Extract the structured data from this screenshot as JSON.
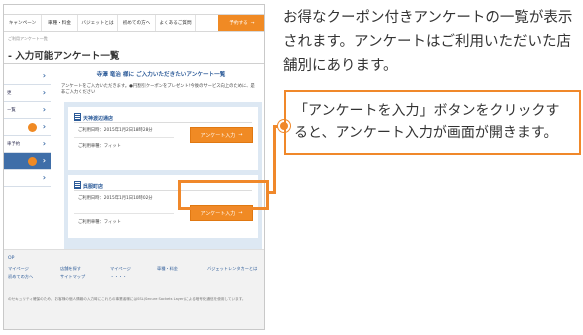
{
  "nav": {
    "items": [
      "キャンペーン",
      "車種・料金",
      "バジェットとは",
      "初めての方へ",
      "よくあるご質問"
    ],
    "cta_label": "予約する",
    "cta_arrow": "→"
  },
  "breadcrumb": "ご利用アンケート一覧",
  "page_title": "- 入力可能アンケート一覧",
  "sidebar": {
    "items": [
      {
        "label": ""
      },
      {
        "label": "更"
      },
      {
        "label": "ー覧"
      },
      {
        "label": ""
      },
      {
        "label": "車予約"
      },
      {
        "label": ""
      },
      {
        "label": ""
      }
    ],
    "chevron": "›"
  },
  "main": {
    "greeting": "寺澤 竜治 様に ご入力いただきたいアンケート一覧",
    "intro": "アンケートをご入力いただきます。●円割引クーポンをプレゼント!今後のサービス向上のために、是非ご入力ください"
  },
  "cards": [
    {
      "store": "天神渡辺通店",
      "date": "ご利用日時：2015年1月2日18時28分",
      "plan": "ご利用車種：フィット",
      "button_label": "アンケート入力",
      "button_arrow": "→"
    },
    {
      "store": "呉服町店",
      "date": "ご利用日時：2015年1月1日10時02分",
      "plan": "ご利用車種：フィット",
      "button_label": "アンケート入力",
      "button_arrow": "→"
    }
  ],
  "footer": {
    "top": "OP",
    "col1": [
      "マイページ",
      "初めての方へ"
    ],
    "col2": [
      "店舗を探す",
      "サイトマップ"
    ],
    "col3": [
      "マイページ",
      "・・・・"
    ],
    "col4": [
      "車種・料金"
    ],
    "col5": [
      "バジェットレンタカーとは"
    ],
    "legal": "のセキュリティ確保のため、お客様の個人情報の入力時にこれらの事業者様にはSSL(Secure Sockets Layer)による暗号化通信を使用しています。"
  },
  "right": {
    "description": "お得なクーポン付きアンケートの一覧が表示されます。アンケートはご利用いただいた店舗別にあります。",
    "callout": "「アンケートを入力」ボタンをクリックすると、アンケート入力が画面が開きます。"
  },
  "colors": {
    "accent": "#f08a24",
    "link_blue": "#2b5a98",
    "panel_blue": "#dde8f3"
  }
}
